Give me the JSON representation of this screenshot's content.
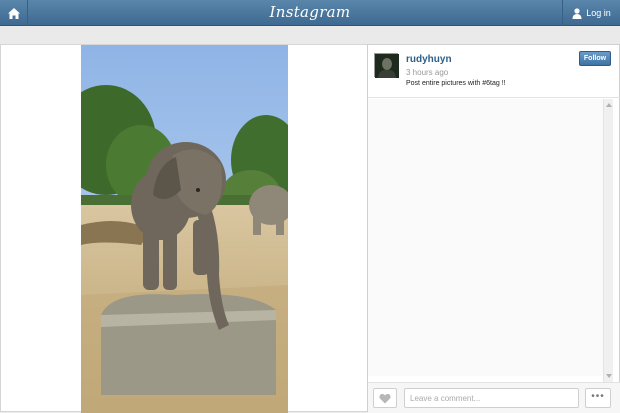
{
  "header": {
    "brand": "Instagram",
    "login_label": "Log in"
  },
  "post": {
    "username": "rudyhuyn",
    "time_ago": "3 hours ago",
    "caption": "Post entire pictures with #6tag !!",
    "follow_label": "Follow",
    "image_alt": "elephant photo"
  },
  "footer": {
    "comment_placeholder": "Leave a comment...",
    "more_label": "•••"
  },
  "colors": {
    "header": "#4b78a0",
    "username": "#2c5f8a",
    "follow": "#3f73a3"
  }
}
